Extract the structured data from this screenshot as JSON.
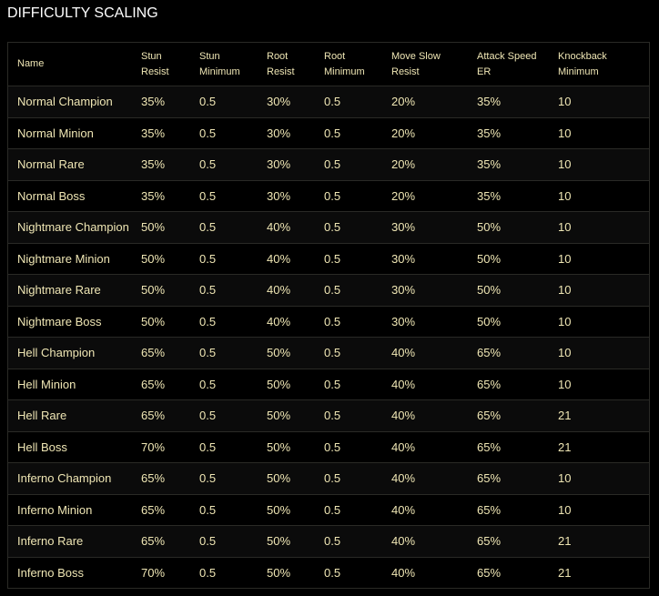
{
  "title": "DIFFICULTY SCALING",
  "colors": {
    "background": "#000000",
    "text": "#efe6b4",
    "title": "#ffffff",
    "row_alt": "#0b0b0b",
    "border": "#2a2a26"
  },
  "table": {
    "headers": [
      {
        "line1": "Name",
        "line2": ""
      },
      {
        "line1": "Stun",
        "line2": "Resist"
      },
      {
        "line1": "Stun",
        "line2": "Minimum"
      },
      {
        "line1": "Root",
        "line2": "Resist"
      },
      {
        "line1": "Root",
        "line2": "Minimum"
      },
      {
        "line1": "Move Slow",
        "line2": "Resist"
      },
      {
        "line1": "Attack Speed",
        "line2": "ER"
      },
      {
        "line1": "Knockback",
        "line2": "Minimum"
      }
    ],
    "rows": [
      [
        "Normal Champion",
        "35%",
        "0.5",
        "30%",
        "0.5",
        "20%",
        "35%",
        "10"
      ],
      [
        "Normal Minion",
        "35%",
        "0.5",
        "30%",
        "0.5",
        "20%",
        "35%",
        "10"
      ],
      [
        "Normal Rare",
        "35%",
        "0.5",
        "30%",
        "0.5",
        "20%",
        "35%",
        "10"
      ],
      [
        "Normal Boss",
        "35%",
        "0.5",
        "30%",
        "0.5",
        "20%",
        "35%",
        "10"
      ],
      [
        "Nightmare Champion",
        "50%",
        "0.5",
        "40%",
        "0.5",
        "30%",
        "50%",
        "10"
      ],
      [
        "Nightmare Minion",
        "50%",
        "0.5",
        "40%",
        "0.5",
        "30%",
        "50%",
        "10"
      ],
      [
        "Nightmare Rare",
        "50%",
        "0.5",
        "40%",
        "0.5",
        "30%",
        "50%",
        "10"
      ],
      [
        "Nightmare Boss",
        "50%",
        "0.5",
        "40%",
        "0.5",
        "30%",
        "50%",
        "10"
      ],
      [
        "Hell Champion",
        "65%",
        "0.5",
        "50%",
        "0.5",
        "40%",
        "65%",
        "10"
      ],
      [
        "Hell Minion",
        "65%",
        "0.5",
        "50%",
        "0.5",
        "40%",
        "65%",
        "10"
      ],
      [
        "Hell Rare",
        "65%",
        "0.5",
        "50%",
        "0.5",
        "40%",
        "65%",
        "21"
      ],
      [
        "Hell Boss",
        "70%",
        "0.5",
        "50%",
        "0.5",
        "40%",
        "65%",
        "21"
      ],
      [
        "Inferno Champion",
        "65%",
        "0.5",
        "50%",
        "0.5",
        "40%",
        "65%",
        "10"
      ],
      [
        "Inferno Minion",
        "65%",
        "0.5",
        "50%",
        "0.5",
        "40%",
        "65%",
        "10"
      ],
      [
        "Inferno Rare",
        "65%",
        "0.5",
        "50%",
        "0.5",
        "40%",
        "65%",
        "21"
      ],
      [
        "Inferno Boss",
        "70%",
        "0.5",
        "50%",
        "0.5",
        "40%",
        "65%",
        "21"
      ]
    ]
  }
}
